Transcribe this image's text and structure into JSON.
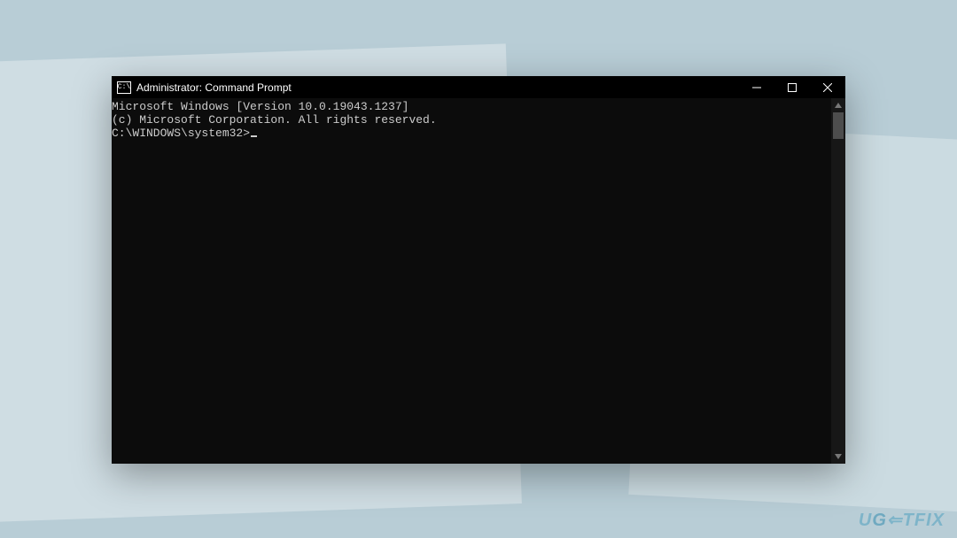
{
  "window": {
    "title": "Administrator: Command Prompt",
    "icon_glyph": "C:\\"
  },
  "terminal": {
    "line1": "Microsoft Windows [Version 10.0.19043.1237]",
    "line2": "(c) Microsoft Corporation. All rights reserved.",
    "blank": "",
    "prompt": "C:\\WINDOWS\\system32>"
  },
  "watermark": {
    "prefix": "U",
    "mid": "G",
    "arrow": "⇐",
    "suffix": "TFIX"
  }
}
